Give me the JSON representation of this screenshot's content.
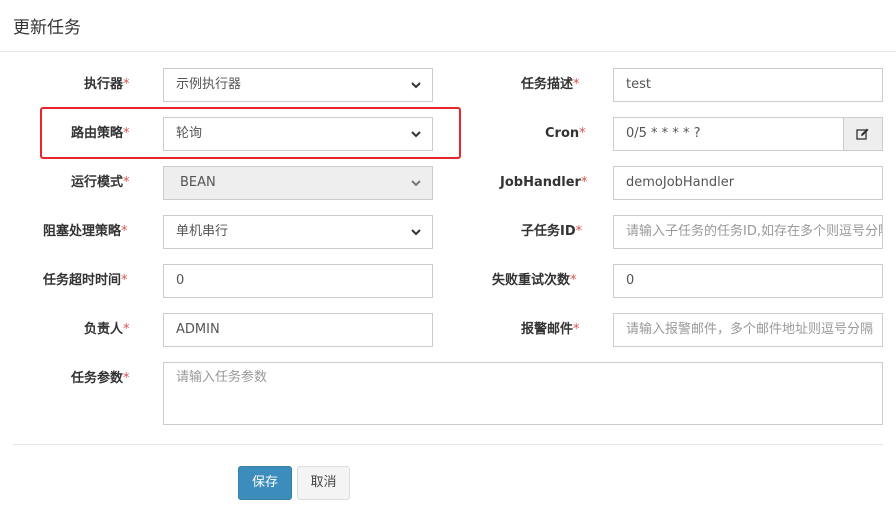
{
  "dialog": {
    "title": "更新任务"
  },
  "form": {
    "executor": {
      "label": "执行器",
      "value": "示例执行器"
    },
    "description": {
      "label": "任务描述",
      "value": "test"
    },
    "route_strategy": {
      "label": "路由策略",
      "value": "轮询"
    },
    "cron": {
      "label": "Cron",
      "value": "0/5 * * * * ?",
      "edit_icon": "edit-icon"
    },
    "run_mode": {
      "label": "运行模式",
      "value": "BEAN"
    },
    "job_handler": {
      "label": "JobHandler",
      "value": "demoJobHandler"
    },
    "block_strategy": {
      "label": "阻塞处理策略",
      "value": "单机串行"
    },
    "child_job_id": {
      "label": "子任务ID",
      "placeholder": "请输入子任务的任务ID,如存在多个则逗号分隔"
    },
    "timeout": {
      "label": "任务超时时间",
      "value": "0"
    },
    "fail_retry": {
      "label": "失败重试次数",
      "value": "0"
    },
    "author": {
      "label": "负责人",
      "value": "ADMIN"
    },
    "alarm_email": {
      "label": "报警邮件",
      "placeholder": "请输入报警邮件，多个邮件地址则逗号分隔"
    },
    "params": {
      "label": "任务参数",
      "placeholder": "请输入任务参数"
    },
    "required_mark": "*"
  },
  "buttons": {
    "save": "保存",
    "cancel": "取消"
  },
  "colors": {
    "primary": "#3c8dbc",
    "required": "#d9534f",
    "highlight": "#e8262a"
  }
}
